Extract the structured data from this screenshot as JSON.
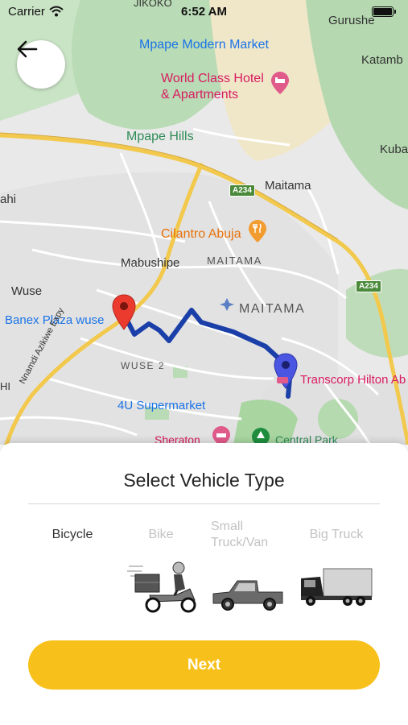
{
  "status_bar": {
    "carrier": "Carrier",
    "time": "6:52 AM"
  },
  "map": {
    "labels": {
      "jikoko": "JIKOKO",
      "gurushe": "Gurushe",
      "mpape_market": "Mpape Modern Market",
      "katamb": "Katamb",
      "world_class_hotel": "World Class Hotel",
      "apartments": "& Apartments",
      "mpape_hills": "Mpape Hills",
      "kuba": "Kuba",
      "ahi": "ahi",
      "maitama_town": "Maitama",
      "a234_top": "A234",
      "cilantro": "Cilantro Abuja",
      "mabushipe": "Mabushipe",
      "maitama_area_small": "MAITAMA",
      "a234_right": "A234",
      "wuse": "Wuse",
      "maitama_area_large": "MAITAMA",
      "banex": "Banex Plaza wuse",
      "transcorp": "Transcorp Hilton Ab",
      "nnamdi": "Nnamdi Azikiwe Expy",
      "wuse2": "WUSE 2",
      "hi": "HI",
      "supermarket": "4U Supermarket",
      "sheraton": "Sheraton",
      "central_park": "Central Park"
    }
  },
  "sheet": {
    "title": "Select Vehicle Type",
    "vehicles": [
      {
        "label": "Bicycle",
        "state": "selected"
      },
      {
        "label": "Bike",
        "state": "unselected"
      },
      {
        "label": "Small Truck/Van",
        "state": "unselected"
      },
      {
        "label": "Big Truck",
        "state": "unselected"
      }
    ],
    "next_label": "Next"
  },
  "colors": {
    "accent": "#f7c01a",
    "route": "#1a3fa8",
    "origin_pin": "#ea3b2e",
    "destination_pin": "#4a56e2",
    "inactive_text": "#c2c2c2"
  },
  "icons": {
    "back": "arrow-left-icon",
    "wifi": "wifi-icon",
    "battery": "battery-icon",
    "hotel": "hotel-icon",
    "restaurant": "restaurant-icon",
    "park": "park-icon"
  }
}
